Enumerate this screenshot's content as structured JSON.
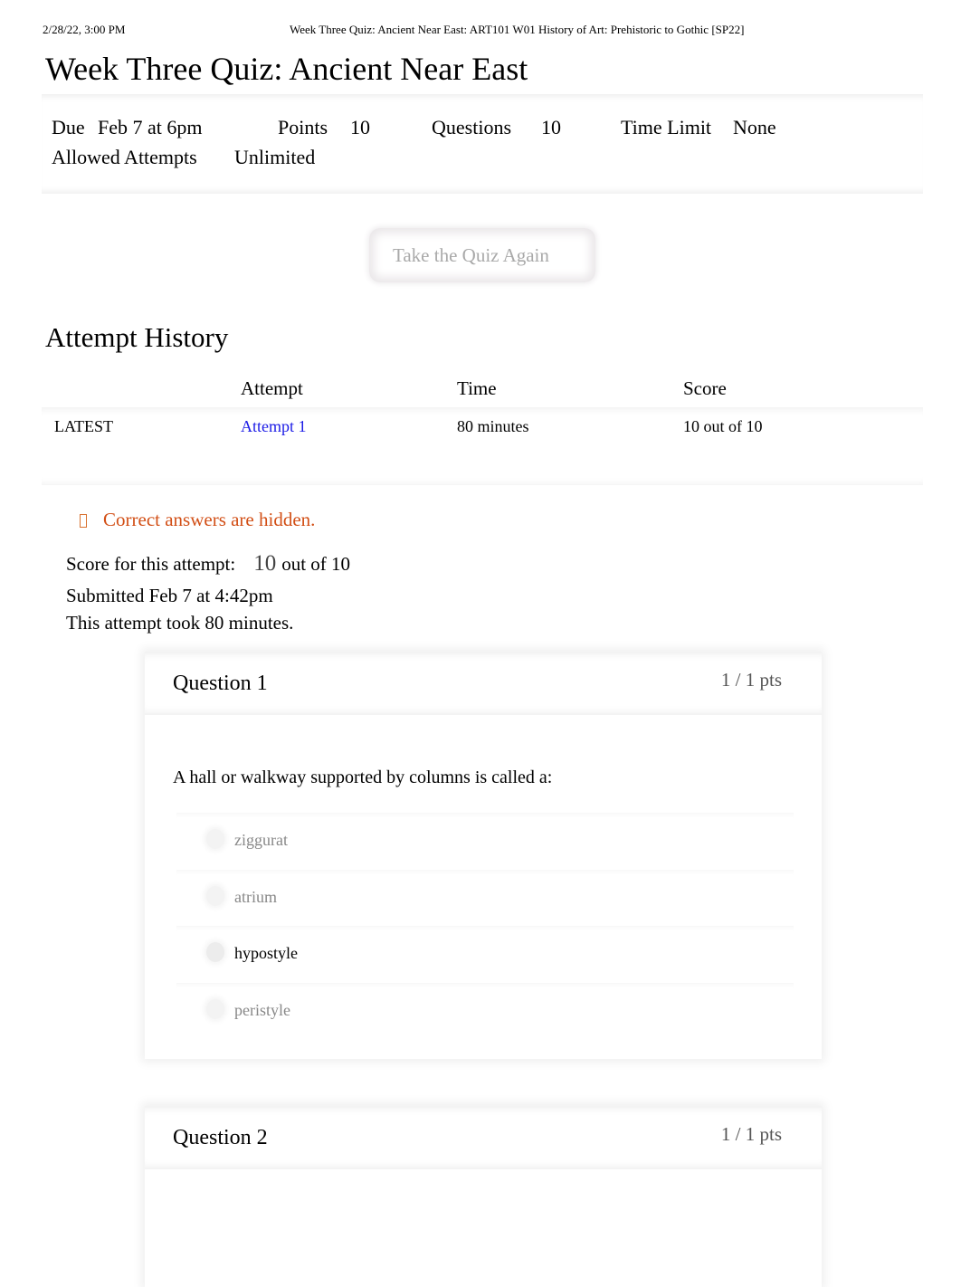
{
  "print_header": {
    "datetime": "2/28/22, 3:00 PM",
    "doc_title": "Week Three Quiz: Ancient Near East: ART101 W01 History of Art: Prehistoric to Gothic [SP22]"
  },
  "page_title": "Week Three Quiz: Ancient Near East",
  "details": {
    "due_label": "Due",
    "due_value": "Feb 7 at 6pm",
    "points_label": "Points",
    "points_value": "10",
    "questions_label": "Questions",
    "questions_value": "10",
    "time_limit_label": "Time Limit",
    "time_limit_value": "None",
    "allowed_attempts_label": "Allowed Attempts",
    "allowed_attempts_value": "Unlimited"
  },
  "take_again_button": "Take the Quiz Again",
  "attempt_history": {
    "title": "Attempt History",
    "columns": [
      "",
      "Attempt",
      "Time",
      "Score"
    ],
    "rows": [
      {
        "tag": "LATEST",
        "attempt": "Attempt 1",
        "time": "80 minutes",
        "score": "10 out of 10"
      }
    ]
  },
  "alert": {
    "icon": "warning-icon",
    "text": "Correct answers are hidden.",
    "color": "#d24f16"
  },
  "result": {
    "score_label": "Score for this attempt:",
    "score_value": "10",
    "score_suffix": "out of 10",
    "submitted": "Submitted Feb 7 at 4:42pm",
    "duration": "This attempt took 80 minutes."
  },
  "questions": [
    {
      "title": "Question 1",
      "points": "1 / 1 pts",
      "text": "A hall or walkway supported by columns is called a:",
      "answers": [
        {
          "label": "ziggurat",
          "selected": false
        },
        {
          "label": "atrium",
          "selected": false
        },
        {
          "label": "hypostyle",
          "selected": true
        },
        {
          "label": "peristyle",
          "selected": false
        }
      ]
    },
    {
      "title": "Question 2",
      "points": "1 / 1 pts"
    }
  ],
  "colors": {
    "link": "#1a1ae6",
    "muted_text": "#888888",
    "button_text": "#a9a9a9"
  }
}
